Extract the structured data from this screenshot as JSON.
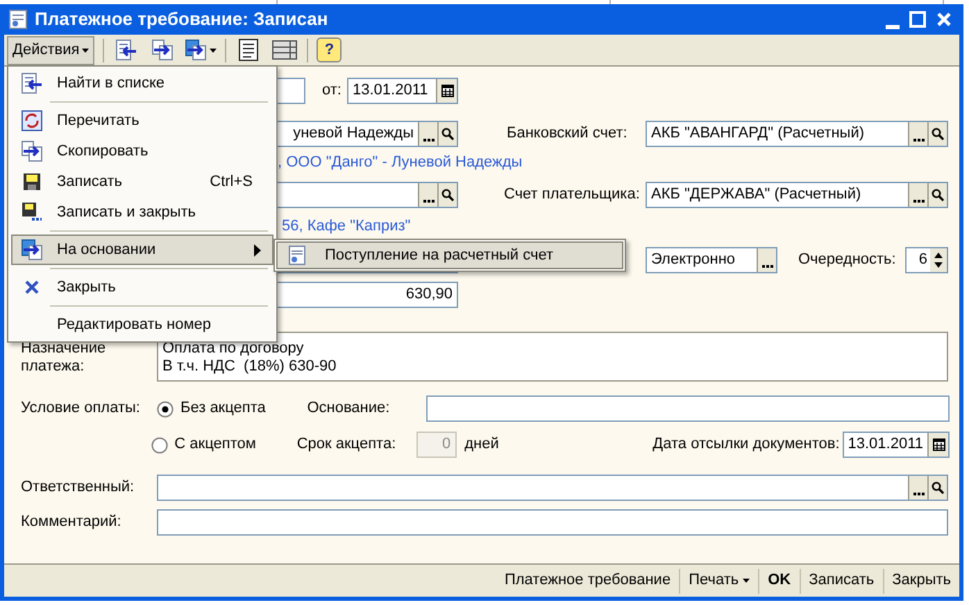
{
  "window": {
    "title": "Платежное требование: Записан"
  },
  "toolbar": {
    "actions": "Действия",
    "help": "?"
  },
  "menu": {
    "groups": [
      [
        {
          "label": "Найти в списке",
          "selected": false
        }
      ],
      [
        {
          "label": "Перечитать",
          "selected": false
        },
        {
          "label": "Скопировать",
          "selected": false
        },
        {
          "label": "Записать",
          "shortcut": "Ctrl+S",
          "selected": false
        },
        {
          "label": "Записать и закрыть",
          "selected": false
        }
      ],
      [
        {
          "label": "На основании",
          "submenu": true,
          "selected": true
        }
      ],
      [
        {
          "label": "Закрыть",
          "selected": false
        }
      ],
      [
        {
          "label": "Редактировать номер",
          "selected": false
        }
      ]
    ]
  },
  "submenu": {
    "items": [
      {
        "label": "Поступление на расчетный счет"
      }
    ]
  },
  "header": {
    "date_label": "от:",
    "date": "13.01.2011"
  },
  "recipient": {
    "value": "уневой Надежды",
    "link": ", ООО \"Данго\" - Луневой Надежды"
  },
  "bank_account": {
    "label": "Банковский счет:",
    "value": "АКБ \"АВАНГАРД\" (Расчетный)"
  },
  "payer": {
    "link": "56, Кафе \"Каприз\""
  },
  "payer_account": {
    "label": "Счет плательщика:",
    "value": "АКБ \"ДЕРЖАВА\" (Расчетный)"
  },
  "payment_type": {
    "value": "Электронно"
  },
  "priority": {
    "label": "Очередность:",
    "value": "6"
  },
  "vat": {
    "value": "630,90"
  },
  "purpose": {
    "label": "Назначение платежа:",
    "lines": [
      "Оплата по договору",
      "В т.ч. НДС  (18%) 630-90"
    ]
  },
  "payment_condition": {
    "label": "Условие оплаты:",
    "options": [
      {
        "label": "Без акцепта",
        "selected": true
      },
      {
        "label": "С акцептом",
        "selected": false
      }
    ]
  },
  "basis": {
    "label": "Основание:"
  },
  "acceptance": {
    "label": "Срок акцепта:",
    "value": "0",
    "unit": "дней",
    "disabled": true
  },
  "docs_date": {
    "label": "Дата отсылки документов:",
    "value": "13.01.2011"
  },
  "responsible": {
    "label": "Ответственный:"
  },
  "comment": {
    "label": "Комментарий:"
  },
  "footer": {
    "buttons": [
      {
        "label": "Платежное требование",
        "dropdown": false,
        "bold": false
      },
      {
        "label": "Печать",
        "dropdown": true,
        "bold": false
      },
      {
        "label": "OK",
        "dropdown": false,
        "bold": true
      },
      {
        "label": "Записать",
        "dropdown": false,
        "bold": false
      },
      {
        "label": "Закрыть",
        "dropdown": false,
        "bold": false
      }
    ]
  }
}
